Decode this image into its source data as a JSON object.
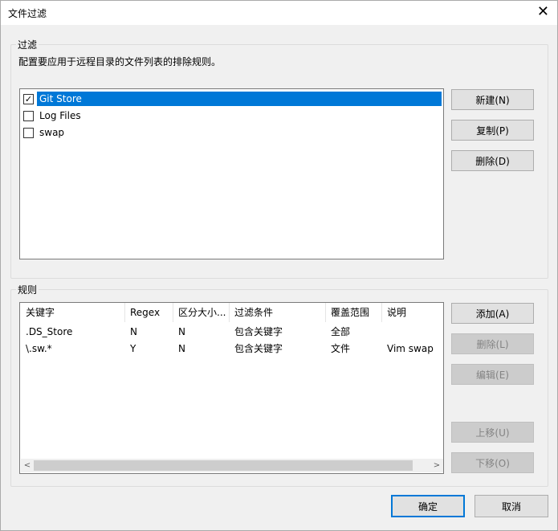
{
  "window": {
    "title": "文件过滤",
    "close_glyph": "✕"
  },
  "filter_group": {
    "label": "过滤",
    "description": "配置要应用于远程目录的文件列表的排除规则。",
    "items": [
      {
        "label": "Git Store",
        "checked": true,
        "selected": true
      },
      {
        "label": "Log Files",
        "checked": false,
        "selected": false
      },
      {
        "label": "swap",
        "checked": false,
        "selected": false
      }
    ],
    "buttons": {
      "new": "新建(N)",
      "copy": "复制(P)",
      "delete": "删除(D)"
    }
  },
  "rules_group": {
    "label": "规则",
    "columns": [
      "关键字",
      "Regex",
      "区分大小...",
      "过滤条件",
      "覆盖范围",
      "说明"
    ],
    "rows": [
      [
        ".DS_Store",
        "N",
        "N",
        "包含关键字",
        "全部",
        ""
      ],
      [
        "\\.sw.*",
        "Y",
        "N",
        "包含关键字",
        "文件",
        "Vim swap"
      ]
    ],
    "buttons": {
      "add": "添加(A)",
      "delete": "删除(L)",
      "edit": "编辑(E)",
      "move_up": "上移(U)",
      "move_down": "下移(O)"
    }
  },
  "footer": {
    "ok": "确定",
    "cancel": "取消"
  },
  "colors": {
    "selection": "#0078d7",
    "primary_border": "#0078d7"
  },
  "icons": {
    "check": "✓",
    "scroll_left": "<",
    "scroll_right": ">"
  }
}
